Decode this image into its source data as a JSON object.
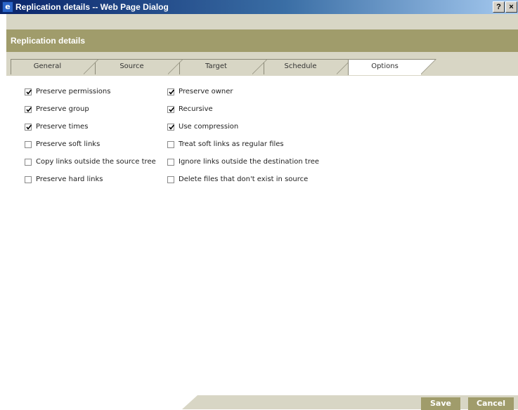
{
  "window": {
    "title": "Replication details -- Web Page Dialog",
    "help_label": "?",
    "close_label": "×",
    "app_icon_glyph": "e"
  },
  "header": {
    "title": "Replication details"
  },
  "tabs": [
    {
      "label": "General",
      "active": false
    },
    {
      "label": "Source",
      "active": false
    },
    {
      "label": "Target",
      "active": false
    },
    {
      "label": "Schedule",
      "active": false
    },
    {
      "label": "Options",
      "active": true
    }
  ],
  "options": {
    "left": [
      {
        "label": "Preserve permissions",
        "checked": true
      },
      {
        "label": "Preserve group",
        "checked": true
      },
      {
        "label": "Preserve times",
        "checked": true
      },
      {
        "label": "Preserve soft links",
        "checked": false
      },
      {
        "label": "Copy links outside the source tree",
        "checked": false
      },
      {
        "label": "Preserve hard links",
        "checked": false
      }
    ],
    "right": [
      {
        "label": "Preserve owner",
        "checked": true
      },
      {
        "label": "Recursive",
        "checked": true
      },
      {
        "label": "Use compression",
        "checked": true
      },
      {
        "label": "Treat soft links as regular files",
        "checked": false
      },
      {
        "label": "Ignore links outside the destination tree",
        "checked": false
      },
      {
        "label": "Delete files that don't exist in source",
        "checked": false
      }
    ]
  },
  "footer": {
    "save_label": "Save",
    "cancel_label": "Cancel"
  },
  "colors": {
    "accent": "#a09c6b",
    "frame": "#d8d6c5",
    "titlebar": "#0a246a"
  }
}
